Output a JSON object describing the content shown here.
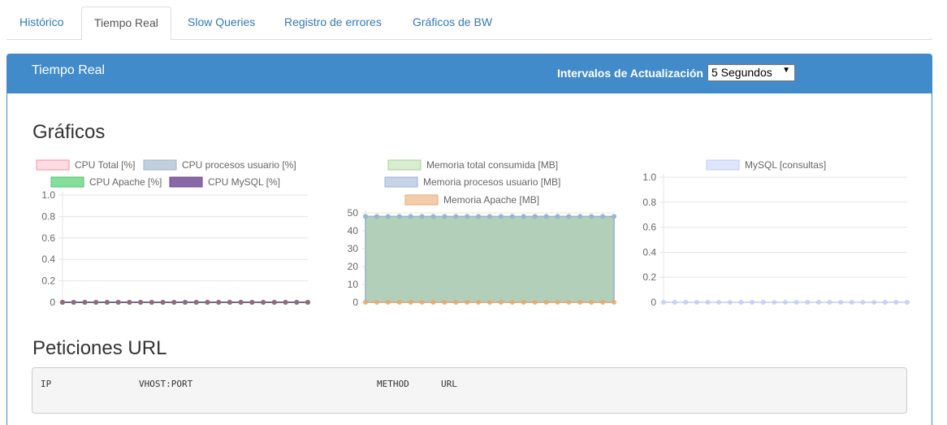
{
  "tabs": [
    {
      "label": "Histórico",
      "active": false
    },
    {
      "label": "Tiempo Real",
      "active": true
    },
    {
      "label": "Slow Queries",
      "active": false
    },
    {
      "label": "Registro de errores",
      "active": false
    },
    {
      "label": "Gráficos de BW",
      "active": false
    }
  ],
  "panel": {
    "title": "Tiempo Real",
    "interval_label": "Intervalos de Actualización",
    "interval_value": "5 Segundos"
  },
  "sections": {
    "graficos": "Gráficos",
    "peticiones": "Peticiones URL"
  },
  "peticiones_table": {
    "columns": [
      "IP",
      "VHOST:PORT",
      "METHOD",
      "URL"
    ]
  },
  "colors": {
    "accent": "#428bca"
  },
  "chart_data": [
    {
      "type": "line",
      "ylim": [
        0,
        1
      ],
      "yticks": [
        "0",
        "0.2",
        "0.4",
        "0.6",
        "0.8",
        "1.0"
      ],
      "series": [
        {
          "name": "CPU Total [%]",
          "fill": "#ffdde3",
          "stroke": "#ff8da1",
          "point": "#ff8da1",
          "values": [
            0,
            0,
            0,
            0,
            0,
            0,
            0,
            0,
            0,
            0,
            0,
            0,
            0,
            0,
            0,
            0,
            0,
            0,
            0,
            0,
            0,
            0,
            0
          ]
        },
        {
          "name": "CPU procesos usuario [%]",
          "fill": "#c0d0de",
          "stroke": "#9fb3c6",
          "point": "#9fb3c6",
          "values": [
            0,
            0,
            0,
            0,
            0,
            0,
            0,
            0,
            0,
            0,
            0,
            0,
            0,
            0,
            0,
            0,
            0,
            0,
            0,
            0,
            0,
            0,
            0
          ]
        },
        {
          "name": "CPU Apache [%]",
          "fill": "#86de9a",
          "stroke": "#4cc26a",
          "point": "#4cc26a",
          "values": [
            0,
            0,
            0,
            0,
            0,
            0,
            0,
            0,
            0,
            0,
            0,
            0,
            0,
            0,
            0,
            0,
            0,
            0,
            0,
            0,
            0,
            0,
            0
          ]
        },
        {
          "name": "CPU MySQL [%]",
          "fill": "#8a6aa6",
          "stroke": "#6b4a8a",
          "point": "#9c5a7a",
          "values": [
            0,
            0,
            0,
            0,
            0,
            0,
            0,
            0,
            0,
            0,
            0,
            0,
            0,
            0,
            0,
            0,
            0,
            0,
            0,
            0,
            0,
            0,
            0
          ]
        }
      ]
    },
    {
      "type": "area",
      "ylim": [
        0,
        50
      ],
      "yticks": [
        "0",
        "10",
        "20",
        "30",
        "40",
        "50"
      ],
      "series": [
        {
          "name": "Memoria total consumida [MB]",
          "fill": "#d8ecd0",
          "stroke": "#a7cf9a",
          "point": "#8fbf8a",
          "values": [
            48,
            48,
            48,
            48,
            48,
            48,
            48,
            48,
            48,
            48,
            48,
            48,
            48,
            48,
            48,
            48,
            48,
            48,
            48,
            48,
            48,
            48,
            48
          ]
        },
        {
          "name": "Memoria procesos usuario [MB]",
          "fill": "#c6d3e8",
          "stroke": "#9db2d6",
          "point": "#9db2d6",
          "values": [
            48,
            48,
            48,
            48,
            48,
            48,
            48,
            48,
            48,
            48,
            48,
            48,
            48,
            48,
            48,
            48,
            48,
            48,
            48,
            48,
            48,
            48,
            48
          ]
        },
        {
          "name": "Memoria Apache [MB]",
          "fill": "#f3ccaa",
          "stroke": "#eaaa78",
          "point": "#e9a866",
          "values": [
            0,
            0,
            0,
            0,
            0,
            0,
            0,
            0,
            0,
            0,
            0,
            0,
            0,
            0,
            0,
            0,
            0,
            0,
            0,
            0,
            0,
            0,
            0
          ]
        }
      ]
    },
    {
      "type": "line",
      "ylim": [
        0,
        1
      ],
      "yticks": [
        "0",
        "0.2",
        "0.4",
        "0.6",
        "0.8",
        "1.0"
      ],
      "series": [
        {
          "name": "MySQL [consultas]",
          "fill": "#dfe5fb",
          "stroke": "#c3cdf5",
          "point": "#c3cdf5",
          "values": [
            0,
            0,
            0,
            0,
            0,
            0,
            0,
            0,
            0,
            0,
            0,
            0,
            0,
            0,
            0,
            0,
            0,
            0,
            0,
            0,
            0,
            0,
            0
          ]
        }
      ]
    }
  ]
}
